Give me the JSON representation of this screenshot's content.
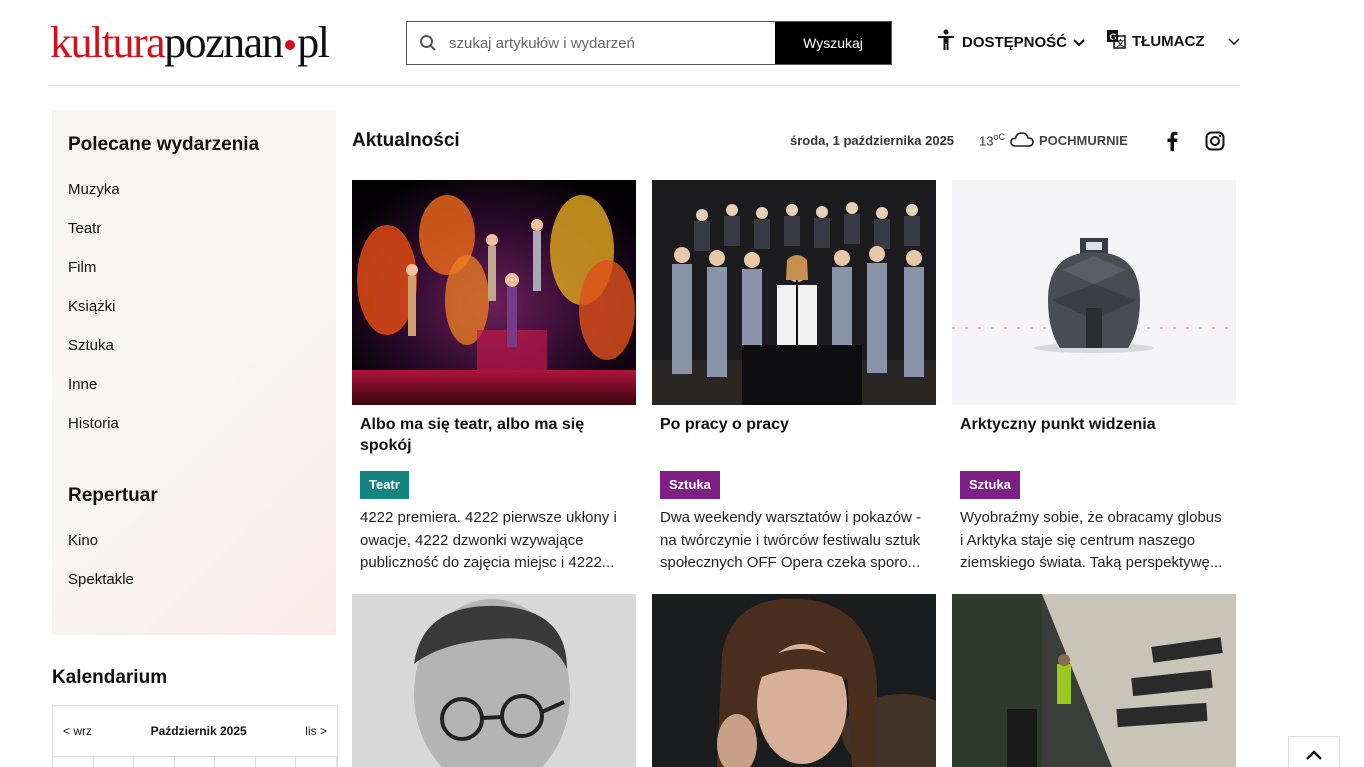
{
  "header": {
    "logo_part1": "kultura",
    "logo_part2": "poznan",
    "logo_part3": "pl",
    "search_placeholder": "szukaj artykułów i wydarzeń",
    "search_button": "Wyszukaj",
    "accessibility": "DOSTĘPNOŚĆ",
    "translator": "TŁUMACZ"
  },
  "sidebar": {
    "polecane_title": "Polecane wydarzenia",
    "polecane_items": [
      "Muzyka",
      "Teatr",
      "Film",
      "Książki",
      "Sztuka",
      "Inne",
      "Historia"
    ],
    "repertuar_title": "Repertuar",
    "repertuar_items": [
      "Kino",
      "Spektakle"
    ]
  },
  "kalendarium": {
    "title": "Kalendarium",
    "prev": "< wrz",
    "month": "Październik 2025",
    "next": "lis >"
  },
  "main": {
    "title": "Aktualności",
    "date": "środa, 1 października 2025",
    "temp": "13",
    "temp_unit": "oC",
    "weather": "POCHMURNIE"
  },
  "cards": [
    {
      "title": "Albo ma się teatr, albo ma się spokój",
      "tag": "Teatr",
      "excerpt": "4222 premiera. 4222 pierwsze ukłony i owacje, 4222 dzwonki wzywające publiczność do zajęcia miejsc i 4222..."
    },
    {
      "title": "Po pracy o pracy",
      "tag": "Sztuka",
      "excerpt": "Dwa weekendy warsztatów i pokazów - na twórczynie i twórców festiwalu sztuk społecznych OFF Opera czeka sporo..."
    },
    {
      "title": "Arktyczny punkt widzenia",
      "tag": "Sztuka",
      "excerpt": "Wyobraźmy sobie, że obracamy globus i Arktyka staje się centrum naszego ziemskiego świata. Taką perspektywę..."
    }
  ],
  "colors": {
    "brand_red": "#d6101b",
    "tag_teatr": "#14857e",
    "tag_sztuka": "#7e1f86"
  }
}
